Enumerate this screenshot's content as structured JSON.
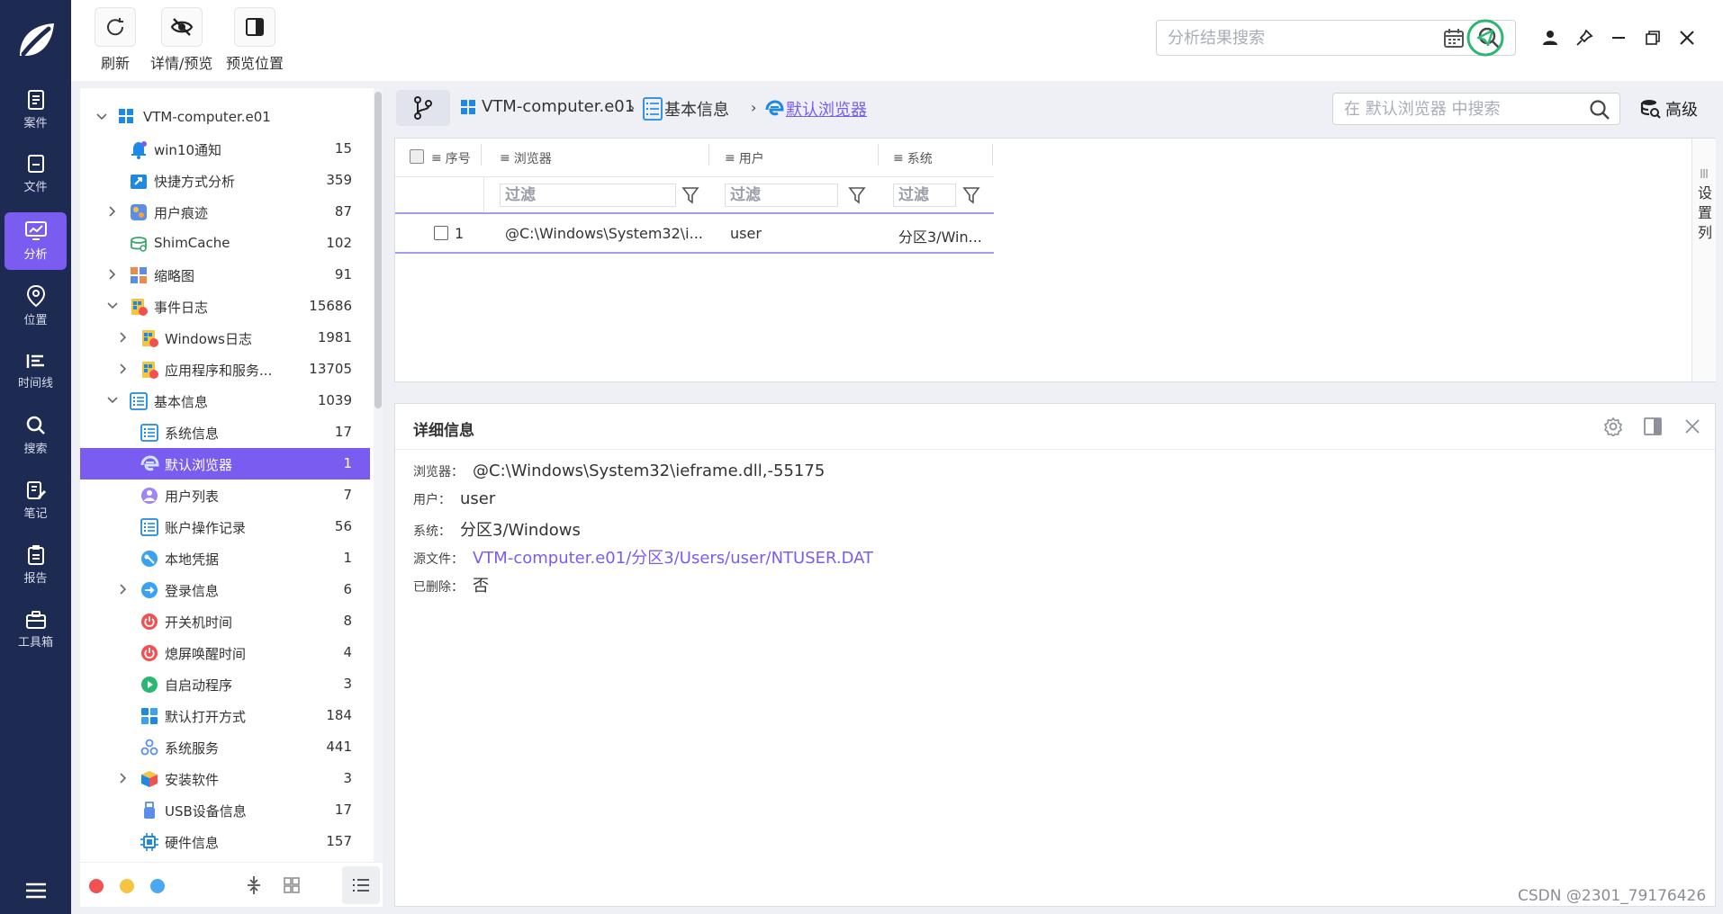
{
  "rail": {
    "items": [
      {
        "label": "案件"
      },
      {
        "label": "文件"
      },
      {
        "label": "分析"
      },
      {
        "label": "位置"
      },
      {
        "label": "时间线"
      },
      {
        "label": "搜索"
      },
      {
        "label": "笔记"
      },
      {
        "label": "报告"
      },
      {
        "label": "工具箱"
      }
    ],
    "active_index": 2,
    "bg_color": "#1d2a52",
    "active_color": "#7b5cf0"
  },
  "toolbar": {
    "refresh_label": "刷新",
    "detail_preview_label": "详情/预览",
    "preview_position_label": "预览位置",
    "search_placeholder": "分析结果搜索",
    "icons": [
      "refresh-icon",
      "eye-off-icon",
      "panel-right-icon",
      "calendar-icon",
      "search-icon",
      "send-icon",
      "user-icon",
      "pin-icon",
      "minimize-icon",
      "maximize-icon",
      "close-icon"
    ]
  },
  "tree": {
    "items": [
      {
        "label": "VTM-computer.e01",
        "count": ""
      },
      {
        "label": "win10通知",
        "count": "15"
      },
      {
        "label": "快捷方式分析",
        "count": "359"
      },
      {
        "label": "用户痕迹",
        "count": "87"
      },
      {
        "label": "ShimCache",
        "count": "102"
      },
      {
        "label": "缩略图",
        "count": "91"
      },
      {
        "label": "事件日志",
        "count": "15686"
      },
      {
        "label": "Windows日志",
        "count": "1981"
      },
      {
        "label": "应用程序和服务...",
        "count": "13705"
      },
      {
        "label": "基本信息",
        "count": "1039"
      },
      {
        "label": "系统信息",
        "count": "17"
      },
      {
        "label": "默认浏览器",
        "count": "1"
      },
      {
        "label": "用户列表",
        "count": "7"
      },
      {
        "label": "账户操作记录",
        "count": "56"
      },
      {
        "label": "本地凭据",
        "count": "1"
      },
      {
        "label": "登录信息",
        "count": "6"
      },
      {
        "label": "开关机时间",
        "count": "8"
      },
      {
        "label": "熄屏唤醒时间",
        "count": "4"
      },
      {
        "label": "自启动程序",
        "count": "3"
      },
      {
        "label": "默认打开方式",
        "count": "184"
      },
      {
        "label": "系统服务",
        "count": "441"
      },
      {
        "label": "安装软件",
        "count": "3"
      },
      {
        "label": "USB设备信息",
        "count": "17"
      },
      {
        "label": "硬件信息",
        "count": "157"
      },
      {
        "label": "",
        "count": ""
      }
    ],
    "selected_index": 11,
    "footer_dot_colors": [
      "#f05252",
      "#f5c542",
      "#4aa8f0"
    ]
  },
  "breadcrumb": {
    "items": [
      "VTM-computer.e01",
      "基本信息",
      "默认浏览器"
    ],
    "search_placeholder": "在 默认浏览器 中搜索",
    "advanced_label": "高级"
  },
  "grid": {
    "columns": [
      "序号",
      "浏览器",
      "用户",
      "系统"
    ],
    "filter_placeholder": "过滤",
    "rows": [
      {
        "index": "1",
        "browser": "@C:\\Windows\\System32\\i...",
        "user": "user",
        "system": "分区3/Win..."
      }
    ],
    "set_columns_label": "设置列"
  },
  "detail": {
    "title": "详细信息",
    "fields": [
      {
        "key": "浏览器：",
        "value": "@C:\\Windows\\System32\\ieframe.dll,-55175"
      },
      {
        "key": "用户：",
        "value": "user"
      },
      {
        "key": "系统：",
        "value": "分区3/Windows"
      },
      {
        "key": "源文件：",
        "value": "VTM-computer.e01/分区3/Users/user/NTUSER.DAT"
      },
      {
        "key": "已删除：",
        "value": "否"
      }
    ],
    "link_color": "#7b5cf0"
  },
  "watermark": "CSDN @2301_79176426"
}
